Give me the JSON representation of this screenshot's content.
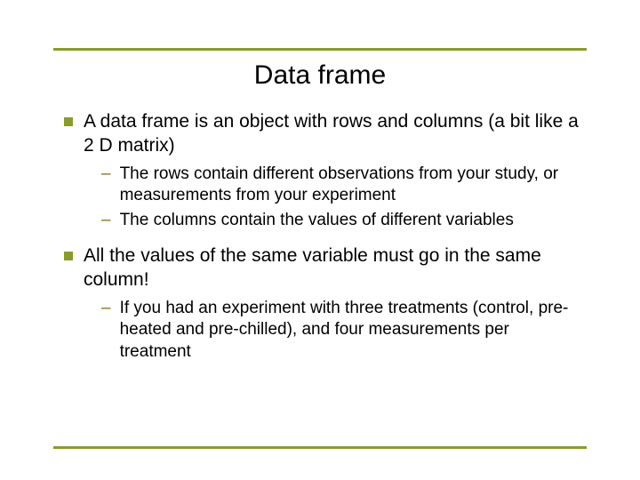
{
  "title": "Data frame",
  "bullets": [
    {
      "text": "A data frame is an object with rows and columns (a bit like a 2 D matrix)",
      "subs": [
        "The rows contain different observations from your study, or measurements from your experiment",
        "The columns contain the values of different variables"
      ]
    },
    {
      "text": "All the values of the same variable must go in the same column!",
      "subs": [
        "If you had an experiment with three treatments (control, pre-heated and pre-chilled), and four measurements per treatment"
      ]
    }
  ]
}
